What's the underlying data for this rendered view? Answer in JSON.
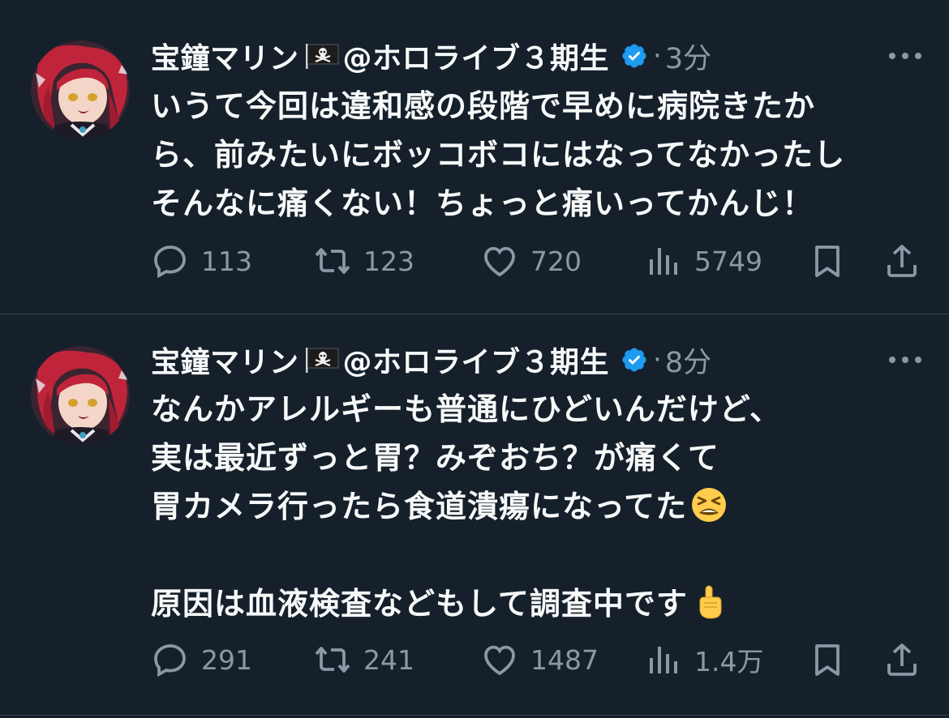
{
  "colors": {
    "background": "#15202b",
    "text_primary": "#f7f9f9",
    "text_secondary": "#8b98a5",
    "verified": "#1d9bf0",
    "divider": "#38444d"
  },
  "tweets": [
    {
      "display_name": "宝鐘マリン",
      "handle": "@ホロライブ３期生",
      "separator": "·",
      "time": "3分",
      "lines": [
        "いうて今回は違和感の段階で早めに病院きたか",
        "ら、前みたいにボッコボコにはなってなかったし",
        "そんなに痛くない！ちょっと痛いってかんじ！"
      ],
      "stats": {
        "replies": "113",
        "retweets": "123",
        "likes": "720",
        "views": "5749"
      },
      "icons": [
        "reply-icon",
        "retweet-icon",
        "like-icon",
        "views-icon",
        "bookmark-icon",
        "share-icon"
      ]
    },
    {
      "display_name": "宝鐘マリン",
      "handle": "@ホロライブ３期生",
      "separator": "·",
      "time": "8分",
      "lines": [
        "なんかアレルギーも普通にひどいんだけど、",
        "実は最近ずっと胃？みぞおち？が痛くて",
        "胃カメラ行ったら食道潰瘍になってた",
        "",
        "原因は血液検査などもして調査中です"
      ],
      "emojis": [
        "tired-face-emoji",
        "pointing-up-emoji"
      ],
      "stats": {
        "replies": "291",
        "retweets": "241",
        "likes": "1487",
        "views": "1.4万"
      },
      "icons": [
        "reply-icon",
        "retweet-icon",
        "like-icon",
        "views-icon",
        "bookmark-icon",
        "share-icon"
      ]
    }
  ]
}
